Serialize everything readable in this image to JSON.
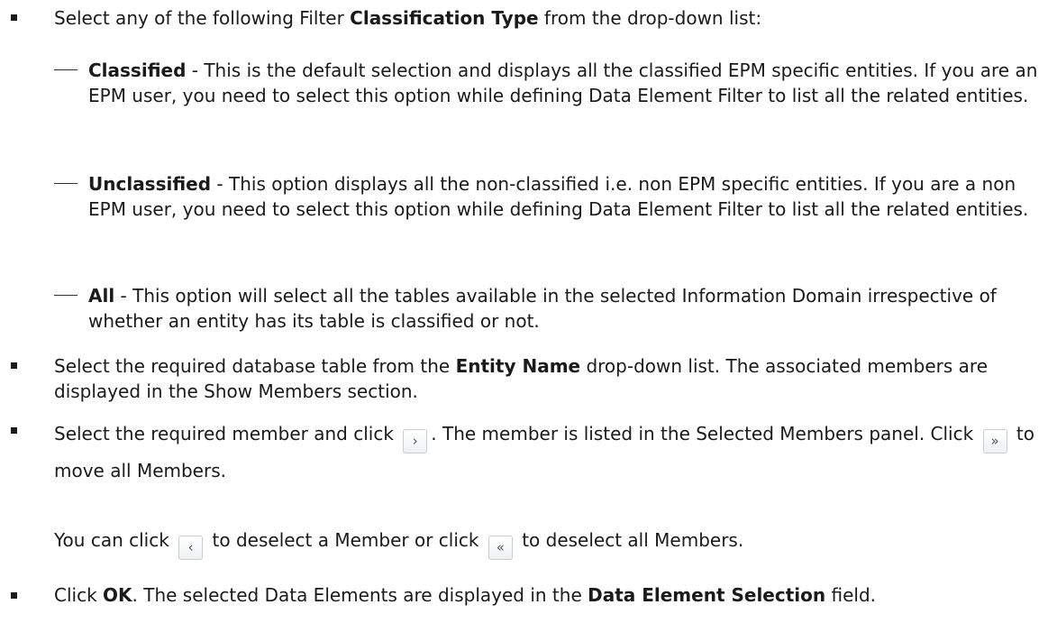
{
  "list": {
    "item1": {
      "pre": "Select any of the following Filter ",
      "bold": "Classification Type",
      "post": " from the drop-down list:"
    },
    "sub1": {
      "bold": "Classified",
      "text": " - This is the default selection and displays all the classified EPM specific entities. If you are an EPM user, you need to select this option while defining Data Element Filter to list all the related entities."
    },
    "sub2": {
      "bold": "Unclassified",
      "text": " - This option displays all the non-classified i.e. non EPM specific entities. If you are a non EPM user, you need to select this option while defining Data Element Filter to list all the related entities."
    },
    "sub3": {
      "bold": "All",
      "text": " - This option will select all the tables available in the selected Information Domain irrespective of whether an entity has its table is classified or not."
    },
    "item2": {
      "pre": "Select the required database table from the ",
      "bold": "Entity Name",
      "post": " drop-down list. The associated members are displayed in the Show Members section."
    },
    "item3": {
      "pre": "Select the required member and click ",
      "mid": ". The member is listed in the Selected Members panel. Click ",
      "post": " to move all Members."
    },
    "item3b": {
      "pre": "You can click ",
      "mid": " to deselect a Member or click ",
      "post": " to deselect all Members."
    },
    "item4": {
      "pre": "Click ",
      "bold1": "OK",
      "mid": ". The selected Data Elements are displayed in the ",
      "bold2": "Data Element Selection",
      "post": " field."
    }
  },
  "icons": {
    "move": "›",
    "move_all": "»",
    "remove": "‹",
    "remove_all": "«"
  }
}
